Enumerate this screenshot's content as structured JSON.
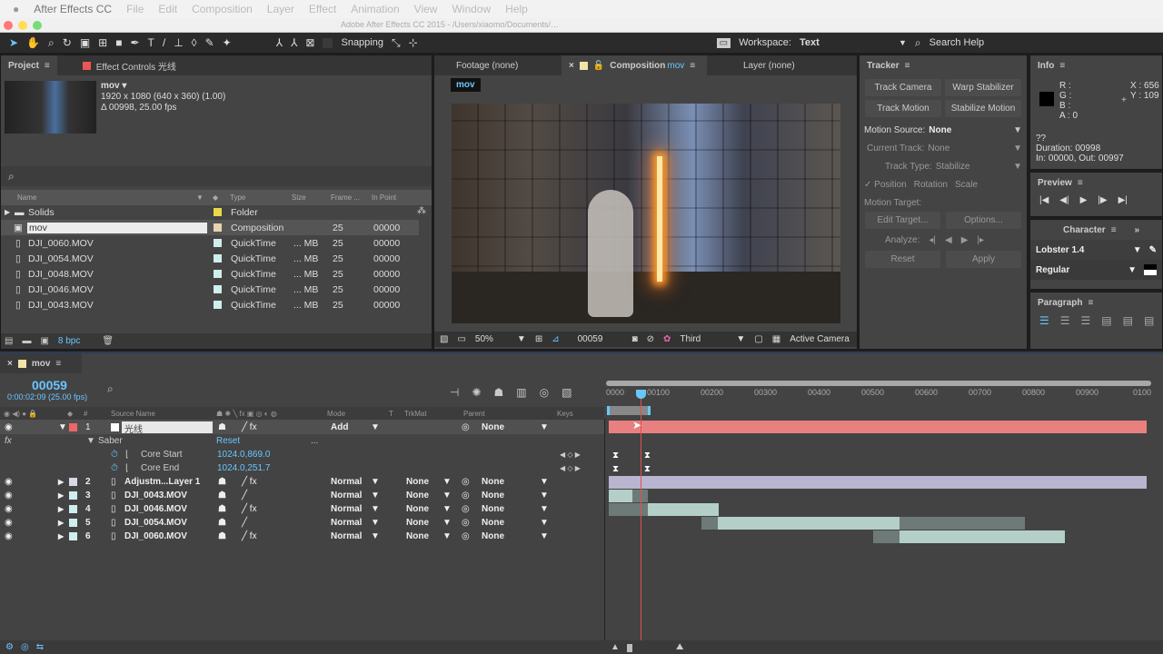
{
  "menubar": {
    "app": "After Effects CC",
    "items": [
      "File",
      "Edit",
      "Composition",
      "Layer",
      "Effect",
      "Animation",
      "View",
      "Window",
      "Help"
    ]
  },
  "titlebar": {
    "title": "Adobe After Effects CC 2015 - /Users/xiaomo/Documents/…"
  },
  "toolbar": {
    "snapping": "Snapping",
    "workspace_label": "Workspace:",
    "workspace": "Text",
    "search": "Search Help"
  },
  "project": {
    "tab": "Project",
    "effect_tab": "Effect Controls 光线",
    "item_name": "mov ▾",
    "item_res": "1920 x 1080  (640 x 360) (1.00)",
    "item_dur": "Δ 00998, 25.00 fps",
    "columns": [
      "Name",
      "Type",
      "Size",
      "Frame ...",
      "In Point"
    ],
    "rows": [
      {
        "name": "Solids",
        "type": "Folder",
        "size": "",
        "fr": "",
        "in": "",
        "color": "#e8d84a"
      },
      {
        "name": "mov",
        "type": "Composition",
        "size": "",
        "fr": "25",
        "in": "00000",
        "color": "#e8d3b0"
      },
      {
        "name": "DJI_0060.MOV",
        "type": "QuickTime",
        "size": "... MB",
        "fr": "25",
        "in": "00000",
        "color": "#cfeeee"
      },
      {
        "name": "DJI_0054.MOV",
        "type": "QuickTime",
        "size": "... MB",
        "fr": "25",
        "in": "00000",
        "color": "#cfeeee"
      },
      {
        "name": "DJI_0048.MOV",
        "type": "QuickTime",
        "size": "... MB",
        "fr": "25",
        "in": "00000",
        "color": "#cfeeee"
      },
      {
        "name": "DJI_0046.MOV",
        "type": "QuickTime",
        "size": "... MB",
        "fr": "25",
        "in": "00000",
        "color": "#cfeeee"
      },
      {
        "name": "DJI_0043.MOV",
        "type": "QuickTime",
        "size": "... MB",
        "fr": "25",
        "in": "00000",
        "color": "#cfeeee"
      }
    ],
    "bpc": "8 bpc"
  },
  "viewer": {
    "tabs": [
      "Footage (none)",
      "Composition",
      "Layer (none)"
    ],
    "comp_name": "mov",
    "breadcrumb": "mov",
    "zoom": "50%",
    "frame": "00059",
    "resolution": "Third",
    "camera": "Active Camera"
  },
  "tracker": {
    "title": "Tracker",
    "track_camera": "Track Camera",
    "warp": "Warp Stabilizer",
    "track_motion": "Track Motion",
    "stabilize": "Stabilize Motion",
    "motion_source_label": "Motion Source:",
    "motion_source": "None",
    "current_track_label": "Current Track:",
    "current_track": "None",
    "track_type_label": "Track Type:",
    "track_type": "Stabilize",
    "position": "✓ Position",
    "rotation": "Rotation",
    "scale": "Scale",
    "motion_target": "Motion Target:",
    "edit_target": "Edit Target...",
    "options": "Options...",
    "analyze": "Analyze:",
    "reset": "Reset",
    "apply": "Apply"
  },
  "info": {
    "title": "Info",
    "r": "R :",
    "g": "G :",
    "b": "B :",
    "a": "A : 0",
    "x": "X : 656",
    "y": "Y : 109",
    "q": "??",
    "duration": "Duration: 00998",
    "inout": "In: 00000, Out: 00997"
  },
  "preview": {
    "title": "Preview"
  },
  "character": {
    "title": "Character",
    "font": "Lobster 1.4",
    "style": "Regular"
  },
  "paragraph": {
    "title": "Paragraph"
  },
  "timeline": {
    "comp": "mov",
    "timecode": "00059",
    "timecode_sub": "0:00:02:09 (25.00 fps)",
    "columns": [
      "#",
      "Source Name",
      "Mode",
      "T",
      "TrkMat",
      "Parent",
      "Keys"
    ],
    "ruler": [
      "0000",
      "00100",
      "00200",
      "00300",
      "00400",
      "00500",
      "00600",
      "00700",
      "00800",
      "00900",
      "0100"
    ],
    "playhead_frame": 59,
    "layer1": {
      "num": "1",
      "name": "光线",
      "mode": "Add",
      "parent": "None"
    },
    "effect": {
      "name": "Saber",
      "reset": "Reset",
      "dots": "...",
      "props": [
        {
          "name": "Core Start",
          "value": "1024.0,869.0"
        },
        {
          "name": "Core End",
          "value": "1024.0,251.7"
        }
      ]
    },
    "layers": [
      {
        "num": "2",
        "name": "Adjustm...Layer 1",
        "mode": "Normal",
        "trkmat": "None",
        "parent": "None"
      },
      {
        "num": "3",
        "name": "DJI_0043.MOV",
        "mode": "Normal",
        "trkmat": "None",
        "parent": "None"
      },
      {
        "num": "4",
        "name": "DJI_0046.MOV",
        "mode": "Normal",
        "trkmat": "None",
        "parent": "None"
      },
      {
        "num": "5",
        "name": "DJI_0054.MOV",
        "mode": "Normal",
        "trkmat": "None",
        "parent": "None"
      },
      {
        "num": "6",
        "name": "DJI_0060.MOV",
        "mode": "Normal",
        "trkmat": "None",
        "parent": "None"
      }
    ]
  },
  "colors": {
    "accent": "#6ac6ff",
    "layer_red": "#e98080",
    "adjust": "#b9b4cf",
    "footage": "#b3cfc8"
  }
}
